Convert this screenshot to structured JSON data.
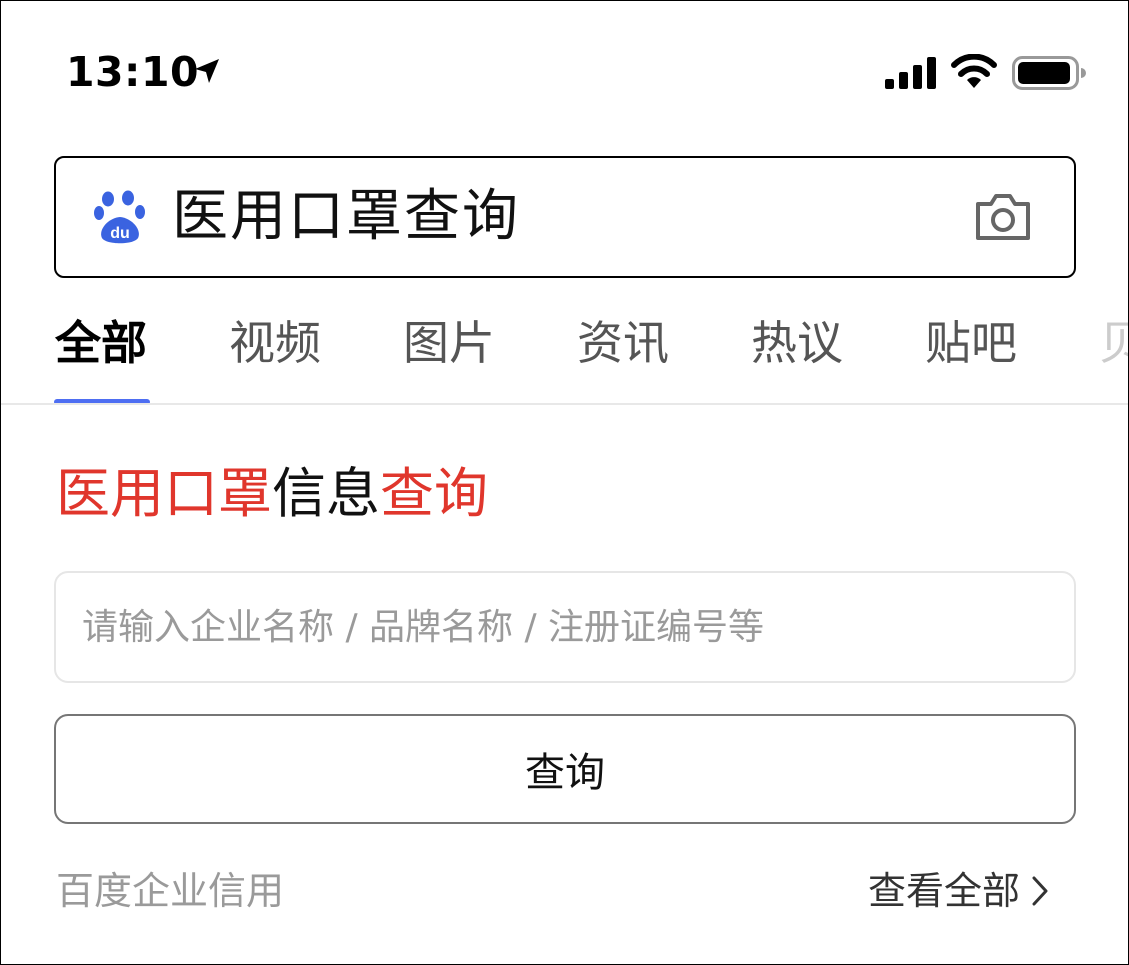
{
  "status_bar": {
    "time": "13:10",
    "icons": [
      "location-arrow-icon",
      "signal-bars-icon",
      "wifi-icon",
      "battery-icon"
    ]
  },
  "search": {
    "logo": "baidu-paw-icon",
    "query": "医用口罩查询",
    "camera_icon": "camera-icon"
  },
  "tabs": [
    {
      "label": "全部",
      "active": true
    },
    {
      "label": "视频",
      "active": false
    },
    {
      "label": "图片",
      "active": false
    },
    {
      "label": "资讯",
      "active": false
    },
    {
      "label": "热议",
      "active": false
    },
    {
      "label": "贴吧",
      "active": false
    },
    {
      "label": "贝",
      "active": false
    }
  ],
  "card": {
    "title_parts": [
      {
        "text": "医用口罩",
        "color": "#e0362c"
      },
      {
        "text": "信息",
        "color": "#111111"
      },
      {
        "text": "查询",
        "color": "#e0362c"
      }
    ],
    "input_placeholder": "请输入企业名称 / 品牌名称 / 注册证编号等",
    "query_button": "查询",
    "source_label": "百度企业信用",
    "view_all": "查看全部"
  },
  "colors": {
    "accent_blue": "#4e6ef2",
    "title_red": "#e0362c"
  }
}
